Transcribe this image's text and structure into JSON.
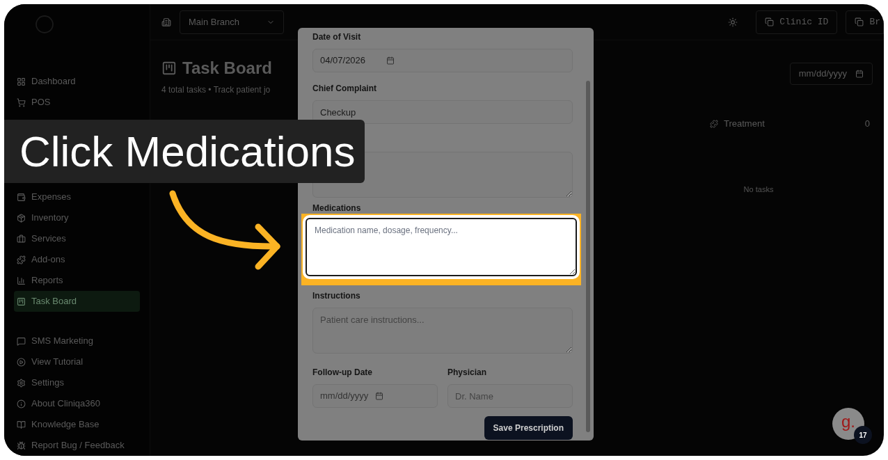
{
  "caption": "Click Medications",
  "header": {
    "branch": "Main Branch",
    "clinic_button": "Clinic ID",
    "branch_button": "Br"
  },
  "sidebar": {
    "groups": [
      {
        "items": [
          {
            "label": "Dashboard",
            "selected": false
          },
          {
            "label": "POS",
            "selected": false
          }
        ]
      },
      {
        "items": [
          {
            "label": "Expenses",
            "selected": false
          },
          {
            "label": "Inventory",
            "selected": false
          },
          {
            "label": "Services",
            "selected": false
          },
          {
            "label": "Add-ons",
            "selected": false
          },
          {
            "label": "Reports",
            "selected": false
          },
          {
            "label": "Task Board",
            "selected": true
          }
        ]
      },
      {
        "items": [
          {
            "label": "SMS Marketing",
            "selected": false
          },
          {
            "label": "View Tutorial",
            "selected": false
          },
          {
            "label": "Settings",
            "selected": false
          },
          {
            "label": "About Cliniqa360",
            "selected": false
          },
          {
            "label": "Knowledge Base",
            "selected": false
          },
          {
            "label": "Report Bug / Feedback",
            "selected": false
          }
        ]
      }
    ]
  },
  "page": {
    "title": "Task Board",
    "subtitle": "4 total tasks • Track patient jo",
    "date_filter": "mm/dd/yyyy",
    "column_title": "Treatment",
    "column_count": "0",
    "empty_text": "No tasks"
  },
  "modal": {
    "date_of_visit": {
      "label": "Date of Visit",
      "value": "04/07/2026"
    },
    "chief_complaint": {
      "label": "Chief Complaint",
      "value": "Checkup"
    },
    "medications": {
      "label": "Medications",
      "placeholder": "Medication name, dosage, frequency...",
      "highlighted": true
    },
    "instructions": {
      "label": "Instructions",
      "placeholder": "Patient care instructions..."
    },
    "follow_up": {
      "label": "Follow-up Date",
      "placeholder": "mm/dd/yyyy"
    },
    "physician": {
      "label": "Physician",
      "placeholder": "Dr. Name"
    },
    "save_button": "Save Prescription"
  },
  "badge": {
    "letter": "g.",
    "count": "17"
  }
}
